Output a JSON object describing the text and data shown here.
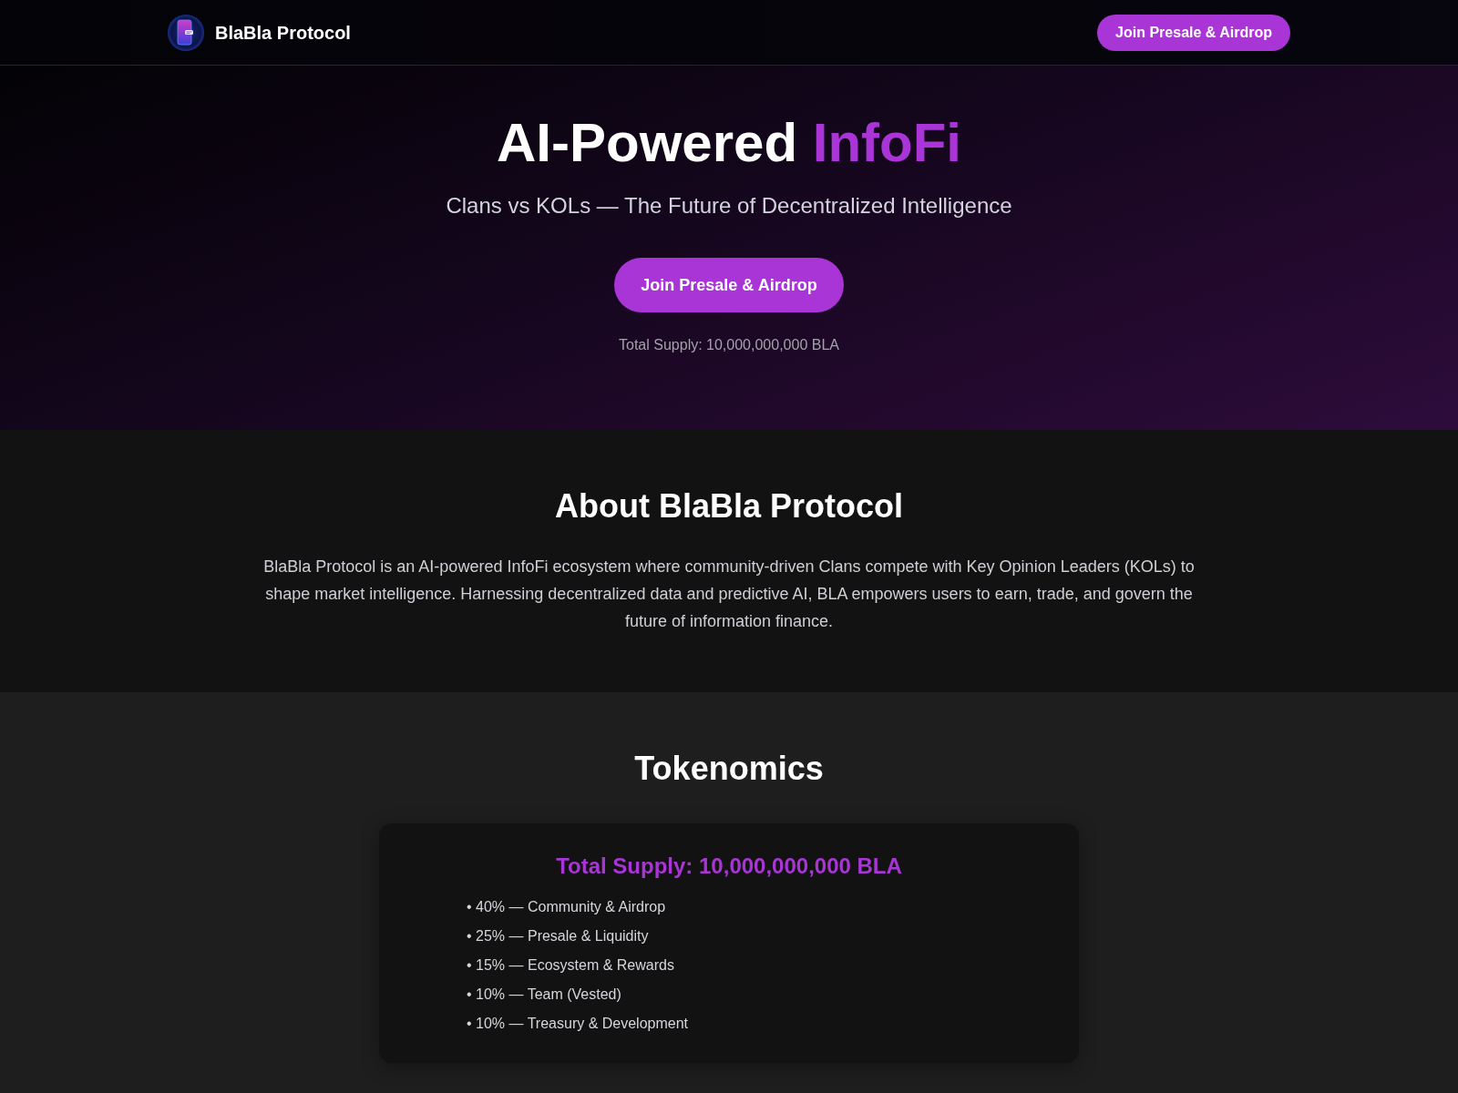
{
  "header": {
    "brand": "BlaBla Protocol",
    "cta_button": "Join Presale & Airdrop"
  },
  "hero": {
    "title_parts": [
      {
        "text": "AI-Powered",
        "highlight": false
      },
      {
        "text": "InfoFi",
        "highlight": true
      }
    ],
    "subtitle": "Clans vs KOLs — The Future of Decentralized Intelligence",
    "cta_button": "Join Presale & Airdrop",
    "supply_note": "Total Supply: 10,000,000,000 BLA"
  },
  "about": {
    "title": "About BlaBla Protocol",
    "paragraph": "BlaBla Protocol is an AI-powered InfoFi ecosystem where community-driven Clans compete with Key Opinion Leaders (KOLs) to shape market intelligence. Harnessing decentralized data and predictive AI, BLA empowers users to earn, trade, and govern the future of information finance."
  },
  "tokenomics": {
    "title": "Tokenomics",
    "card": {
      "title": "Total Supply: 10,000,000,000 BLA",
      "items": [
        "• 40% — Community & Airdrop",
        "• 25% — Presale & Liquidity",
        "• 15% — Ecosystem & Rewards",
        "• 10% — Team (Vested)",
        "• 10% — Treasury & Development"
      ]
    }
  }
}
